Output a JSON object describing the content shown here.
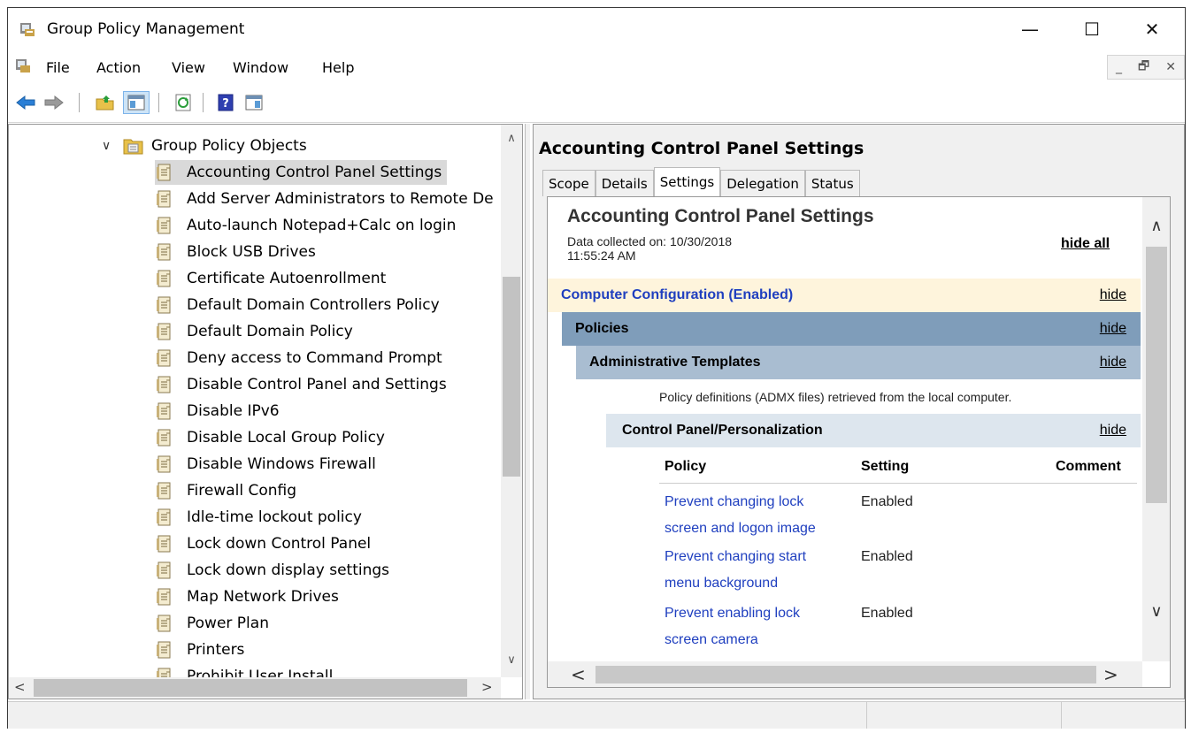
{
  "window": {
    "title": "Group Policy Management",
    "controls": {
      "minimize": "—",
      "maximize": "☐",
      "close": "✕"
    }
  },
  "menu": {
    "items": [
      "File",
      "Action",
      "View",
      "Window",
      "Help"
    ],
    "mdi": {
      "minimize": "_",
      "restore": "🗗",
      "close": "✕"
    }
  },
  "toolbar": {
    "icons": [
      "back-arrow-icon",
      "forward-arrow-icon",
      "up-folder-icon",
      "show-hide-tree-icon",
      "refresh-icon",
      "help-icon",
      "properties-icon"
    ]
  },
  "tree": {
    "root": "Group Policy Objects",
    "items": [
      "Accounting Control Panel Settings",
      "Add Server Administrators to Remote De",
      "Auto-launch Notepad+Calc on login",
      "Block USB Drives",
      "Certificate Autoenrollment",
      "Default Domain Controllers Policy",
      "Default Domain Policy",
      "Deny access to Command Prompt",
      "Disable Control Panel and Settings",
      "Disable IPv6",
      "Disable Local Group Policy",
      "Disable Windows Firewall",
      "Firewall Config",
      "Idle-time lockout policy",
      "Lock down Control Panel",
      "Lock down display settings",
      "Map Network Drives",
      "Power Plan",
      "Printers",
      "Prohibit User Install"
    ],
    "selected_index": 0
  },
  "details": {
    "title": "Accounting Control Panel Settings",
    "tabs": [
      "Scope",
      "Details",
      "Settings",
      "Delegation",
      "Status"
    ],
    "active_tab": "Settings"
  },
  "report": {
    "title": "Accounting Control Panel Settings",
    "data_collected_label": "Data collected on: 10/30/2018",
    "data_collected_time": "11:55:24 AM",
    "hide_all": "hide all",
    "computer_config": "Computer Configuration (Enabled)",
    "policies": "Policies",
    "admin_templates": "Administrative Templates",
    "policy_definitions": "Policy definitions (ADMX files) retrieved from the local computer.",
    "control_panel": "Control Panel/Personalization",
    "hide": "hide",
    "columns": [
      "Policy",
      "Setting",
      "Comment"
    ],
    "rows": [
      {
        "name_line1": "Prevent changing lock",
        "name_line2": "screen and logon image",
        "setting": "Enabled"
      },
      {
        "name_line1": "Prevent changing start",
        "name_line2": "menu background",
        "setting": "Enabled"
      },
      {
        "name_line1": "Prevent enabling lock",
        "name_line2": "screen camera",
        "setting": "Enabled"
      }
    ]
  },
  "colors": {
    "computer_config_bg": "#fef4dc",
    "policies_bg": "#7f9dba",
    "admin_templates_bg": "#a9bdd1",
    "control_panel_bg": "#dde6ee",
    "link": "#1f3fbf"
  }
}
